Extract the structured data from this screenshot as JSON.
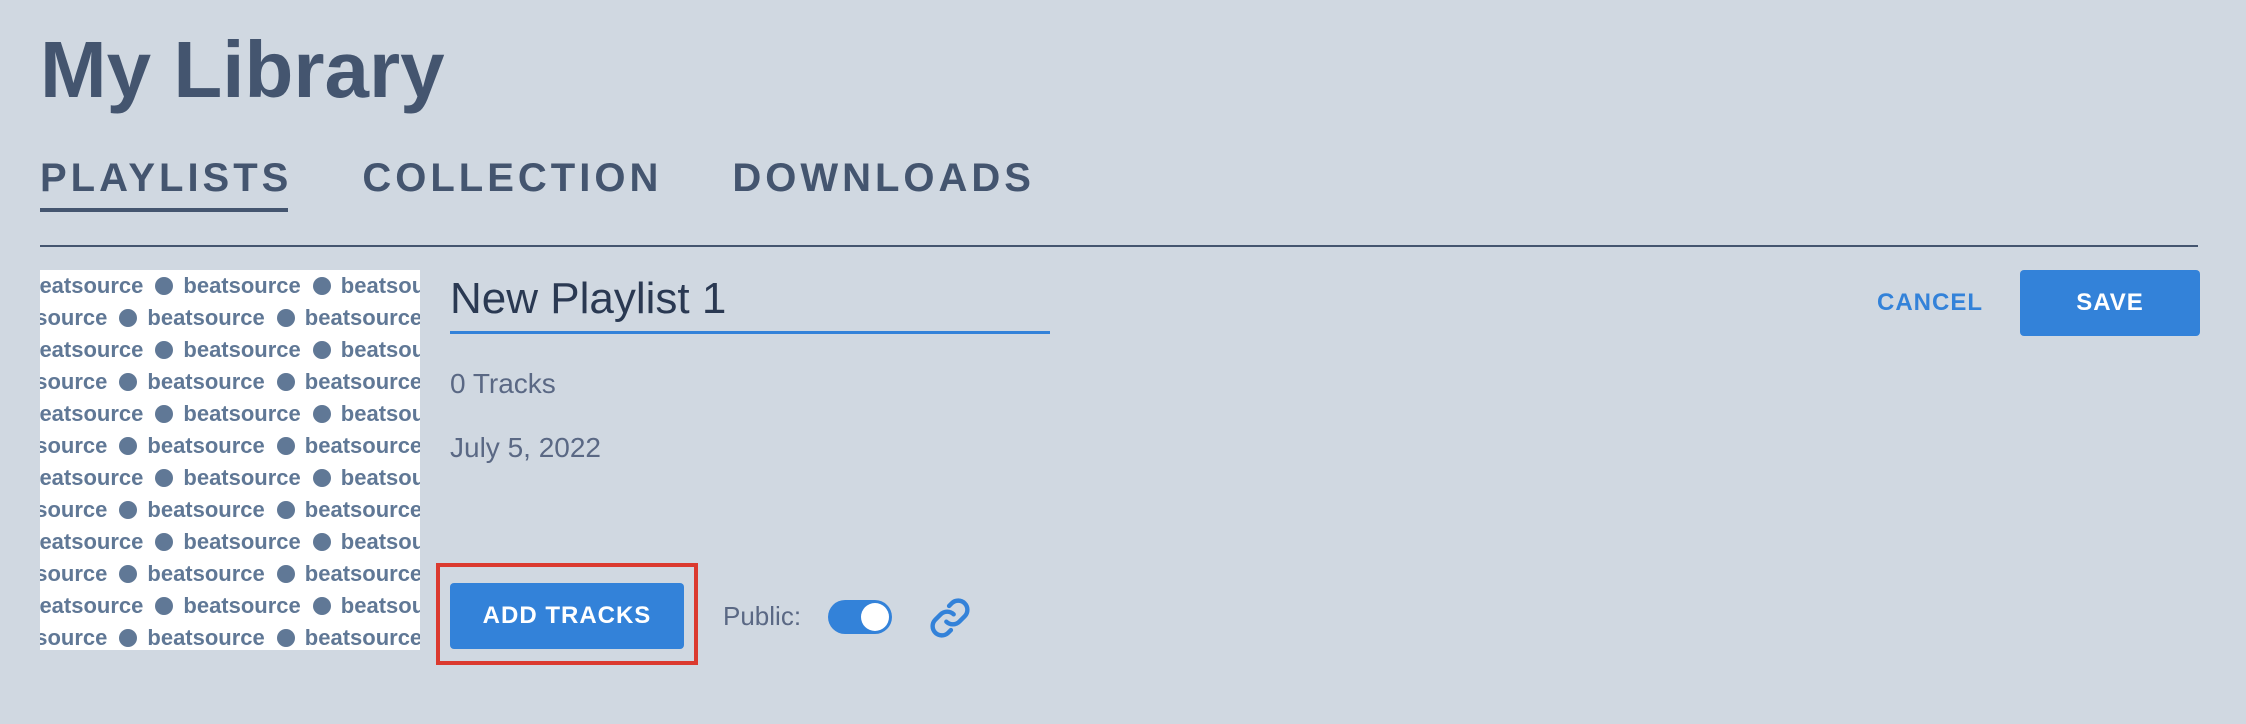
{
  "header": {
    "title": "My Library"
  },
  "tabs": [
    {
      "label": "PLAYLISTS",
      "active": true
    },
    {
      "label": "COLLECTION",
      "active": false
    },
    {
      "label": "DOWNLOADS",
      "active": false
    }
  ],
  "artwork": {
    "pattern_text": "beatsource"
  },
  "playlist": {
    "name": "New Playlist 1",
    "tracks": "0 Tracks",
    "date": "July 5, 2022",
    "public_label": "Public:",
    "public_enabled": true
  },
  "actions": {
    "cancel": "CANCEL",
    "save": "SAVE",
    "add_tracks": "ADD TRACKS"
  },
  "colors": {
    "background": "#d0d8e1",
    "text": "#44556f",
    "accent": "#3382d9",
    "highlight": "#db3a2f"
  },
  "icons": {
    "share_link": "link-icon"
  }
}
